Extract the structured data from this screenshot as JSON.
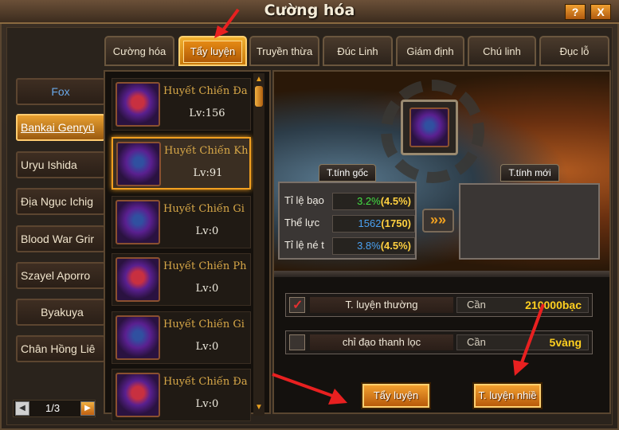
{
  "window": {
    "title": "Cường hóa",
    "help_label": "?",
    "close_label": "X"
  },
  "tabs": [
    {
      "label": "Cường hóa"
    },
    {
      "label": "Tẩy luyện"
    },
    {
      "label": "Truyền thừa"
    },
    {
      "label": "Đúc Linh"
    },
    {
      "label": "Giám định"
    },
    {
      "label": "Chú linh"
    },
    {
      "label": "Đục lỗ"
    }
  ],
  "characters": [
    {
      "name": "Fox"
    },
    {
      "name": "Bankai Genryū"
    },
    {
      "name": "Uryu Ishida"
    },
    {
      "name": "Địa Ngục Ichig"
    },
    {
      "name": "Blood War Grir"
    },
    {
      "name": "Szayel Aporro"
    },
    {
      "name": "Byakuya"
    },
    {
      "name": "Chân Hồng Liê"
    }
  ],
  "pager": {
    "text": "1/3",
    "prev_icon": "◀",
    "next_icon": "▶"
  },
  "items": [
    {
      "name": "Huyết Chiến Đa",
      "level": "Lv:156"
    },
    {
      "name": "Huyết Chiến Kh",
      "level": "Lv:91"
    },
    {
      "name": "Huyết Chiến Gi",
      "level": "Lv:0"
    },
    {
      "name": "Huyết Chiến Ph",
      "level": "Lv:0"
    },
    {
      "name": "Huyết Chiến Gi",
      "level": "Lv:0"
    },
    {
      "name": "Huyết Chiến Đa",
      "level": "Lv:0"
    }
  ],
  "scroll": {
    "up": "▲",
    "down": "▼"
  },
  "refine": {
    "orig_label": "T.tính gốc",
    "new_label": "T.tính mới",
    "arrow": "»»",
    "stats": [
      {
        "label": "Tỉ lệ bạo",
        "value": "3.2%",
        "bonus": "(4.5%)",
        "color_class": "v-green"
      },
      {
        "label": "Thể lực",
        "value": "1562",
        "bonus": "(1750)",
        "color_class": "v-blue"
      },
      {
        "label": "Tỉ lệ né t",
        "value": "3.8%",
        "bonus": "(4.5%)",
        "color_class": "v-blue"
      }
    ]
  },
  "options": [
    {
      "name": "T. luyện thường",
      "can_label": "Cần",
      "cost": "210000bạc",
      "checked": true,
      "check": "✓"
    },
    {
      "name": "chỉ đạo thanh lọc",
      "can_label": "Cần",
      "cost": "5vàng",
      "checked": false,
      "check": ""
    }
  ],
  "actions": {
    "refine_label": "Tẩy luyện",
    "multi_label": "T. luyện nhiề"
  },
  "colors": {
    "accent": "#f2a020",
    "arrow": "#e82020"
  }
}
